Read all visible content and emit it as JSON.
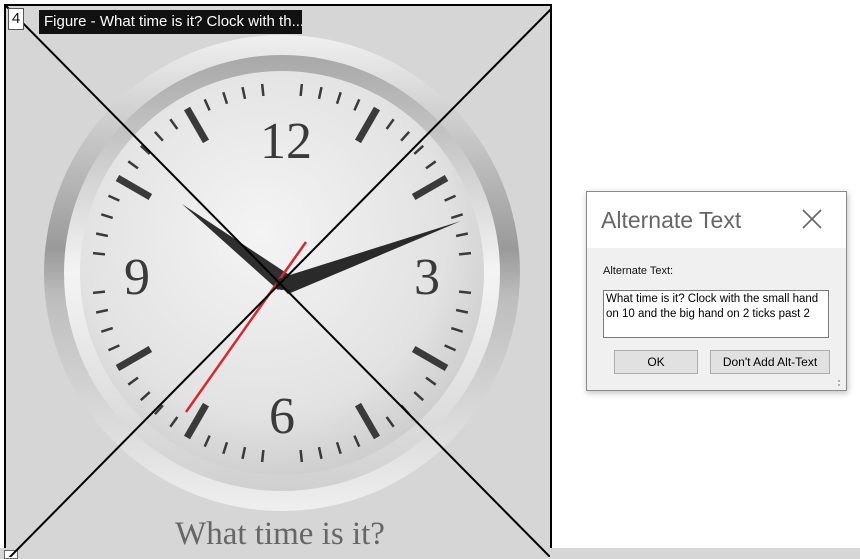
{
  "figure": {
    "number": "4",
    "title": "Figure - What time is it? Clock with th...",
    "caption": "What time is it?",
    "clock_numerals": {
      "twelve": "12",
      "three": "3",
      "six": "6",
      "nine": "9"
    },
    "clock_hands": {
      "hour_hand_on": 10,
      "minute_hand_minutes": 12
    }
  },
  "dialog": {
    "title": "Alternate Text",
    "field_label": "Alternate Text:",
    "alt_text_value": "What time is it? Clock with the small hand on 10 and the big hand on 2 ticks past 2",
    "ok_label": "OK",
    "dont_add_label": "Don't Add Alt-Text"
  }
}
